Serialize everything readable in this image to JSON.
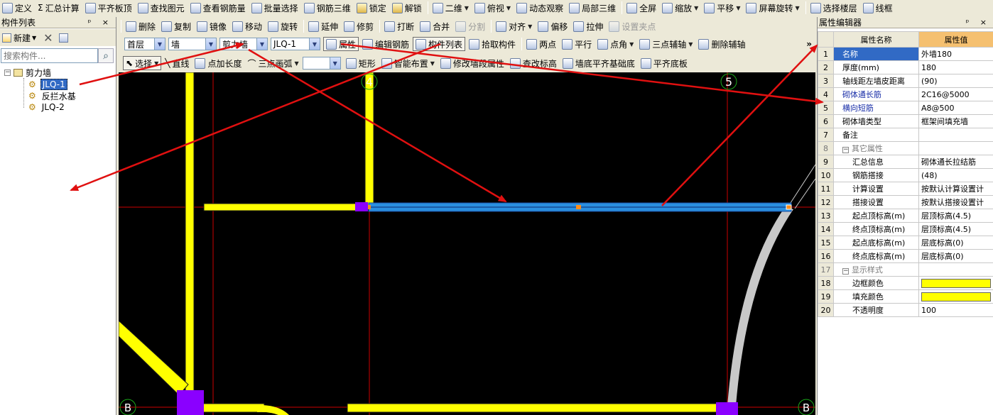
{
  "toolbar1": {
    "items": [
      "定义",
      "汇总计算",
      "平齐板顶",
      "查找图元",
      "查看钢筋量",
      "批量选择",
      "钢筋三维",
      "锁定",
      "解锁",
      "二维",
      "俯视",
      "动态观察",
      "局部三维",
      "全屏",
      "缩放",
      "平移",
      "屏幕旋转",
      "选择楼层",
      "线框"
    ]
  },
  "toolbar2": {
    "items": [
      "删除",
      "复制",
      "镜像",
      "移动",
      "旋转",
      "延伸",
      "修剪",
      "打断",
      "合并",
      "分割",
      "对齐",
      "偏移",
      "拉伸",
      "设置夹点"
    ]
  },
  "toolbar3": {
    "floor": "首层",
    "category": "墙",
    "type": "剪力墙",
    "component": "JLQ-1",
    "items": [
      "属性",
      "编辑钢筋",
      "构件列表",
      "拾取构件",
      "两点",
      "平行",
      "点角",
      "三点辅轴",
      "删除辅轴"
    ],
    "more": "»"
  },
  "toolbar4": {
    "select": "选择",
    "items": [
      "直线",
      "点加长度",
      "三点画弧"
    ],
    "blank_combo": "",
    "items2": [
      "矩形",
      "智能布置",
      "修改墙段属性",
      "查改标高",
      "墙底平齐基础底",
      "平齐底板"
    ]
  },
  "left_panel": {
    "title": "构件列表",
    "controls": "ᵖ ×",
    "new_label": "新建",
    "search_placeholder": "搜索构件...",
    "tree_root": "剪力墙",
    "tree_items": [
      "JLQ-1",
      "反拦水基",
      "JLQ-2"
    ]
  },
  "canvas": {
    "axis_labels": [
      "4",
      "5",
      "B",
      "B"
    ]
  },
  "props": {
    "title": "属性编辑器",
    "controls": "ᵖ ×",
    "col_name": "属性名称",
    "col_value": "属性值",
    "rows": [
      {
        "n": "1",
        "name": "名称",
        "value": "外墙180"
      },
      {
        "n": "2",
        "name": "厚度(mm)",
        "value": "180"
      },
      {
        "n": "3",
        "name": "轴线距左墙皮距离",
        "value": "(90)"
      },
      {
        "n": "4",
        "name": "砌体通长筋",
        "value": "2C16@5000"
      },
      {
        "n": "5",
        "name": "横向短筋",
        "value": "A8@500"
      },
      {
        "n": "6",
        "name": "砌体墙类型",
        "value": "框架间填充墙"
      },
      {
        "n": "7",
        "name": "备注",
        "value": ""
      },
      {
        "n": "8",
        "name": "其它属性",
        "value": ""
      },
      {
        "n": "9",
        "name": "汇总信息",
        "value": "砌体通长拉结筋"
      },
      {
        "n": "10",
        "name": "钢筋搭接",
        "value": "(48)"
      },
      {
        "n": "11",
        "name": "计算设置",
        "value": "按默认计算设置计"
      },
      {
        "n": "12",
        "name": "搭接设置",
        "value": "按默认搭接设置计"
      },
      {
        "n": "13",
        "name": "起点顶标高(m)",
        "value": "层顶标高(4.5)"
      },
      {
        "n": "14",
        "name": "终点顶标高(m)",
        "value": "层顶标高(4.5)"
      },
      {
        "n": "15",
        "name": "起点底标高(m)",
        "value": "层底标高(0)"
      },
      {
        "n": "16",
        "name": "终点底标高(m)",
        "value": "层底标高(0)"
      },
      {
        "n": "17",
        "name": "显示样式",
        "value": ""
      },
      {
        "n": "18",
        "name": "边框颜色",
        "value": ""
      },
      {
        "n": "19",
        "name": "填充颜色",
        "value": ""
      },
      {
        "n": "20",
        "name": "不透明度",
        "value": "100"
      }
    ]
  },
  "colors": {
    "wall_yellow": "#ffff00",
    "selected_wall": "#2a8fe0",
    "axis_red": "#cc0000",
    "column_purple": "#8a00ff",
    "annotation_red": "#e01010"
  }
}
